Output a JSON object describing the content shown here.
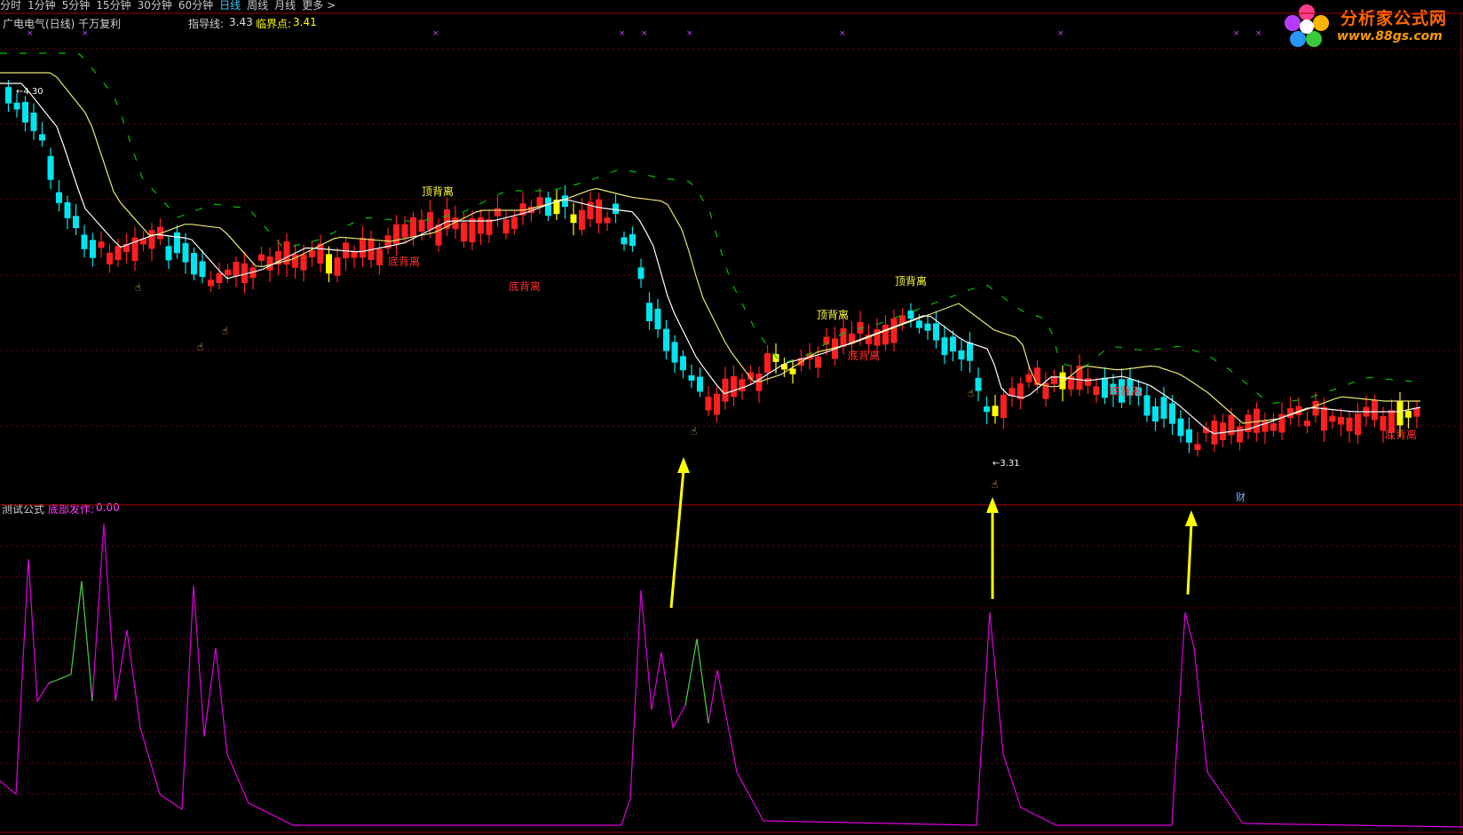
{
  "toolbar": {
    "items": [
      "分时",
      "1分钟",
      "5分钟",
      "15分钟",
      "30分钟",
      "60分钟",
      "日线",
      "周线",
      "月线",
      "更多 >"
    ],
    "active_index": 6
  },
  "logo": {
    "name": "分析家公式网",
    "url": "www.88gs.com"
  },
  "main_panel": {
    "title": "广电电气(日线) 千万复利",
    "guide_line_label": "指导线:",
    "guide_line_value": "3.43",
    "critical_point_label": "临界点:",
    "critical_point_value": "3.41",
    "max_price_label": "4.30",
    "min_price_label": "3.31",
    "cai_marker": "财",
    "annotations": {
      "top_divergence": "顶背离",
      "bottom_divergence": "底背离"
    }
  },
  "sub_panel": {
    "title": "测试公式",
    "indicator_label": "底部发作:",
    "indicator_value": "0.00"
  },
  "colors": {
    "up": "#ff1f1f",
    "down": "#00e5ee",
    "signal": "#ffff00",
    "ma_white": "#ffffff",
    "ma_yellow": "#e8e870",
    "ma_green": "#00c000",
    "indicator": "#e000e0",
    "indicator_alt": "#30d030",
    "grid": "#7a0000"
  }
}
